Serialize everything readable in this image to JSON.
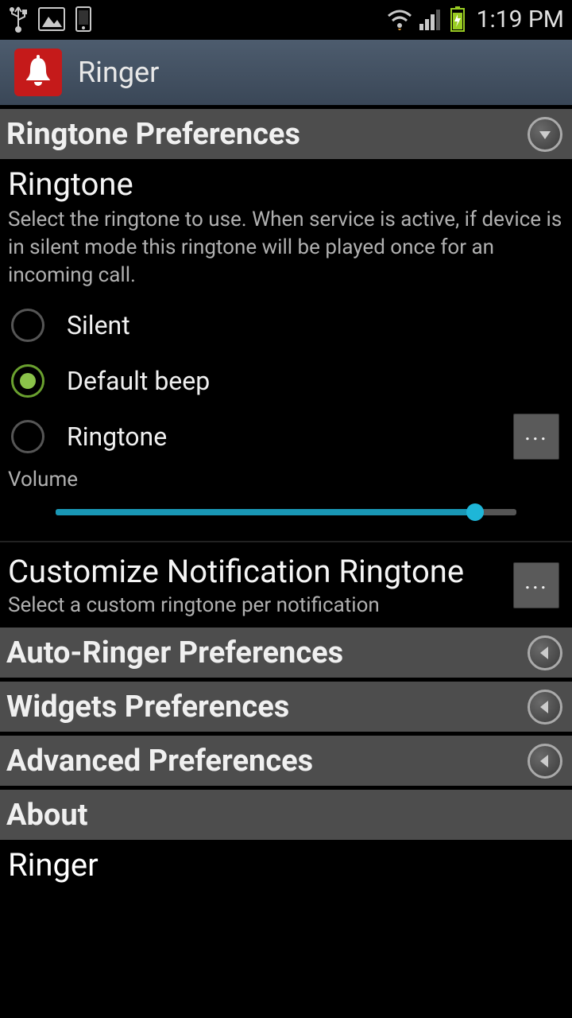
{
  "status": {
    "time": "1:19 PM"
  },
  "app": {
    "title": "Ringer"
  },
  "sections": {
    "ringtone_prefs": {
      "title": "Ringtone Preferences"
    },
    "auto_ringer": {
      "title": "Auto-Ringer Preferences"
    },
    "widgets": {
      "title": "Widgets Preferences"
    },
    "advanced": {
      "title": "Advanced Preferences"
    },
    "about": {
      "title": "About"
    }
  },
  "ringtone": {
    "title": "Ringtone",
    "desc": "Select the ringtone to use. When service is active, if device is in silent mode this ringtone will be played once for an incoming call.",
    "options": {
      "silent": {
        "label": "Silent",
        "checked": false
      },
      "default": {
        "label": "Default beep",
        "checked": true
      },
      "custom": {
        "label": "Ringtone",
        "checked": false
      }
    },
    "more_btn": "...",
    "volume_label": "Volume",
    "volume_percent": 91
  },
  "customize": {
    "title": "Customize Notification Ringtone",
    "desc": "Select a custom ringtone per notification",
    "more_btn": "..."
  },
  "about_content": {
    "app_name": "Ringer"
  }
}
